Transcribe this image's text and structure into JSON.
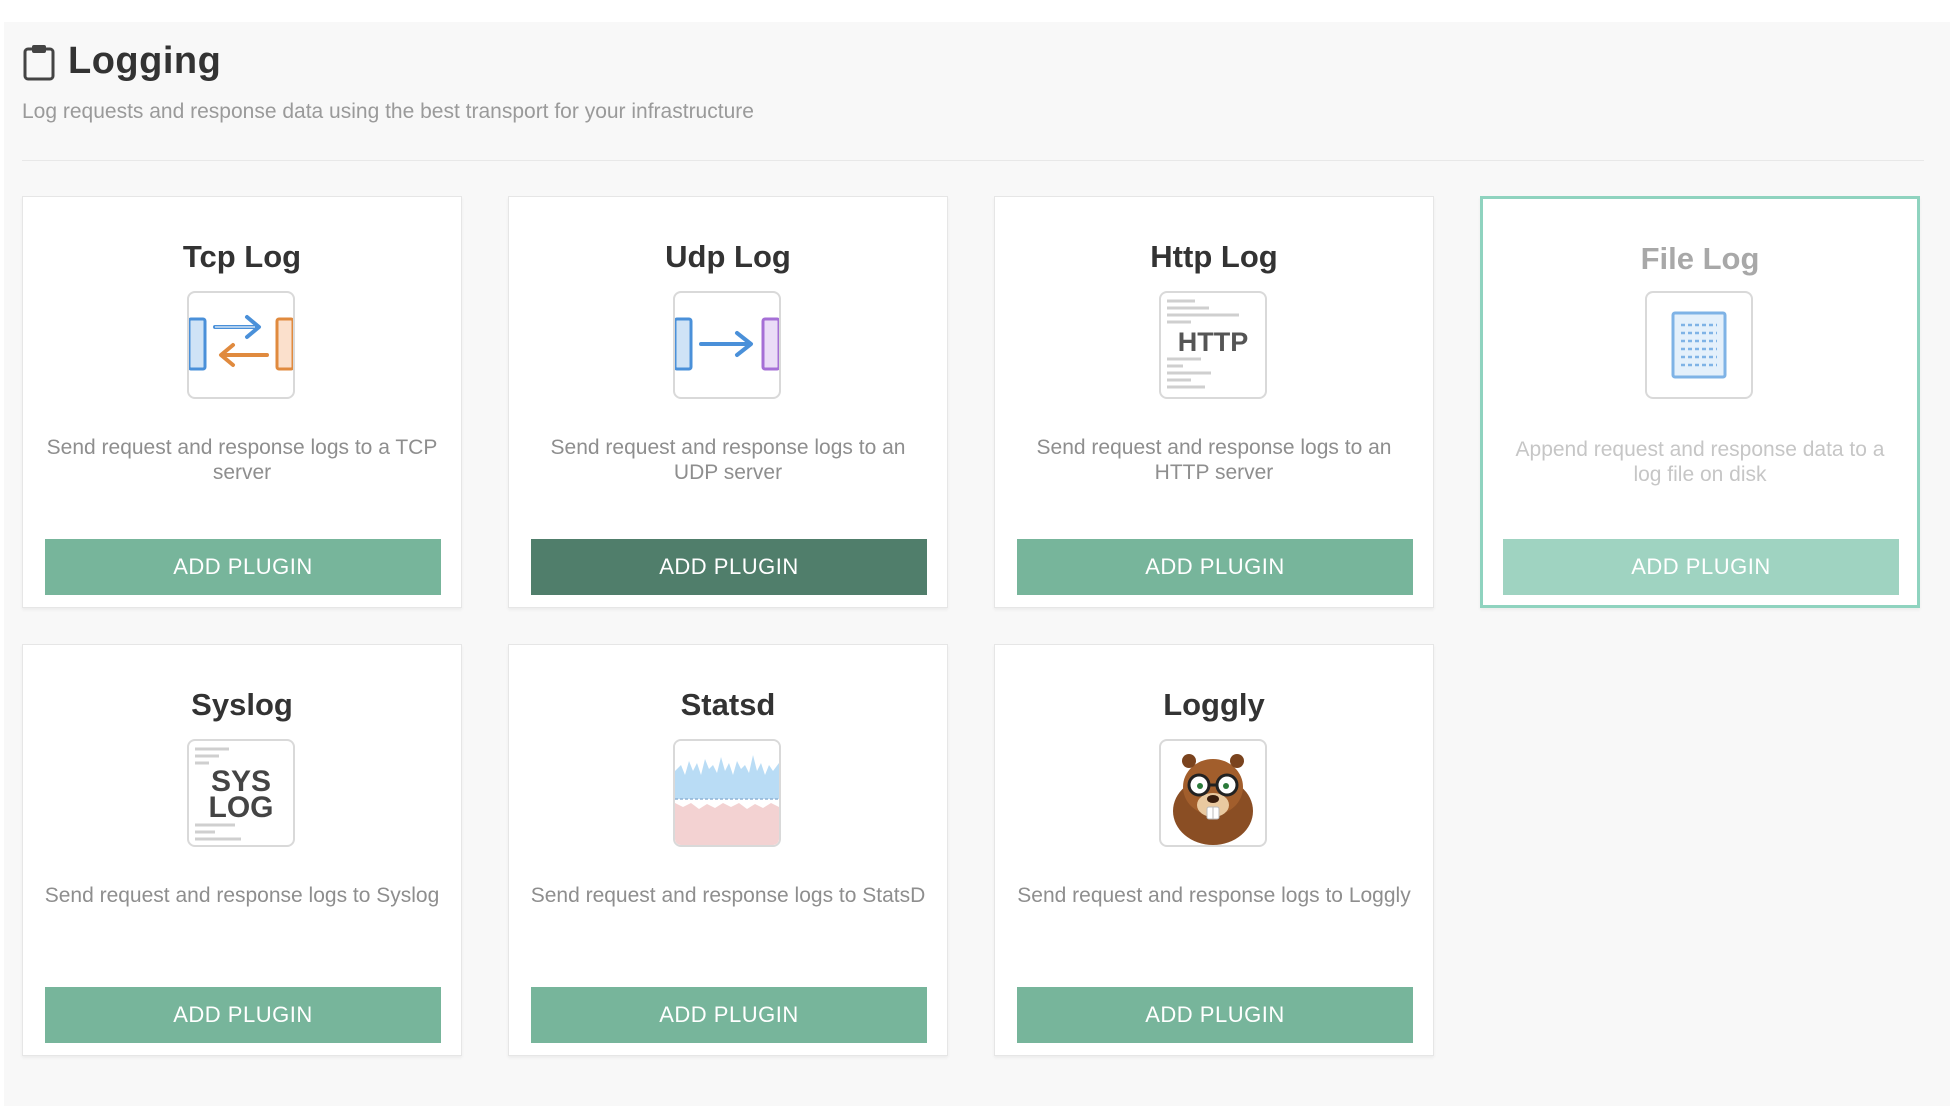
{
  "section": {
    "title": "Logging",
    "subtitle": "Log requests and response data using the best transport for your infrastructure"
  },
  "plugins": [
    {
      "title": "Tcp Log",
      "icon": "tcp-arrows-icon",
      "description": "Send request and response logs to a TCP server",
      "button": "ADD PLUGIN"
    },
    {
      "title": "Udp Log",
      "icon": "udp-arrow-icon",
      "description": "Send request and response logs to an UDP server",
      "button": "ADD PLUGIN",
      "state": "pressed"
    },
    {
      "title": "Http Log",
      "icon": "http-icon",
      "icon_text": "HTTP",
      "description": "Send request and response logs to an HTTP server",
      "button": "ADD PLUGIN"
    },
    {
      "title": "File Log",
      "icon": "file-document-icon",
      "description": "Append request and response data to a log file on disk",
      "button": "ADD PLUGIN",
      "state": "selected"
    },
    {
      "title": "Syslog",
      "icon": "syslog-icon",
      "icon_text_1": "SYS",
      "icon_text_2": "LOG",
      "description": "Send request and response logs to Syslog",
      "button": "ADD PLUGIN"
    },
    {
      "title": "Statsd",
      "icon": "statsd-graph-icon",
      "description": "Send request and response logs to StatsD",
      "button": "ADD PLUGIN"
    },
    {
      "title": "Loggly",
      "icon": "loggly-beaver-icon",
      "description": "Send request and response logs to Loggly",
      "button": "ADD PLUGIN"
    }
  ],
  "colors": {
    "button": "#77b59b",
    "button_pressed": "#507e6b",
    "button_selected_card": "#9fd3c1",
    "selected_border": "#8fd3bf"
  }
}
